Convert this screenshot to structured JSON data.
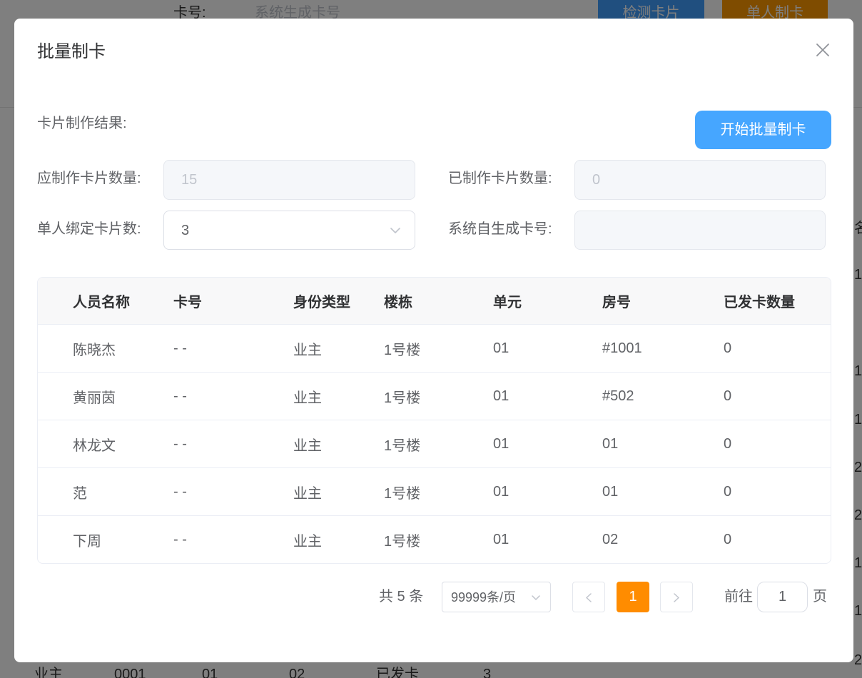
{
  "background": {
    "card_label": "卡号:",
    "card_placeholder": "系统生成卡号",
    "detect_button": "检测卡片",
    "single_button": "单人制卡",
    "bottom_row": [
      "业主",
      "0001",
      "01",
      "02",
      "已发卡",
      "3"
    ],
    "right_column": [
      "名",
      "1",
      "1",
      "1",
      "2",
      "2",
      "1",
      "1",
      "2"
    ]
  },
  "dialog": {
    "title": "批量制卡",
    "result_label": "卡片制作结果:",
    "start_button": "开始批量制卡",
    "fields": {
      "should_make_label": "应制作卡片数量:",
      "should_make_value": "15",
      "made_label": "已制作卡片数量:",
      "made_value": "0",
      "bind_count_label": "单人绑定卡片数:",
      "bind_count_value": "3",
      "system_card_label": "系统自生成卡号:"
    },
    "table": {
      "columns": [
        "人员名称",
        "卡号",
        "身份类型",
        "楼栋",
        "单元",
        "房号",
        "已发卡数量"
      ],
      "rows": [
        {
          "name": "陈晓杰",
          "card_no": "- -",
          "identity_type": "业主",
          "building": "1号楼",
          "unit": "01",
          "room": "#1001",
          "issued_count": "0"
        },
        {
          "name": "黄丽茵",
          "card_no": "- -",
          "identity_type": "业主",
          "building": "1号楼",
          "unit": "01",
          "room": "#502",
          "issued_count": "0"
        },
        {
          "name": "林龙文",
          "card_no": "- -",
          "identity_type": "业主",
          "building": "1号楼",
          "unit": "01",
          "room": "01",
          "issued_count": "0"
        },
        {
          "name": "范",
          "card_no": "- -",
          "identity_type": "业主",
          "building": "1号楼",
          "unit": "01",
          "room": "01",
          "issued_count": "0"
        },
        {
          "name": "下周",
          "card_no": "- -",
          "identity_type": "业主",
          "building": "1号楼",
          "unit": "01",
          "room": "02",
          "issued_count": "0"
        }
      ]
    },
    "pagination": {
      "total_text": "共 5 条",
      "page_size": "99999条/页",
      "current_page": "1",
      "goto_label": "前往",
      "goto_value": "1",
      "page_suffix": "页"
    }
  },
  "icons": {
    "close": "close-icon",
    "select_arrow": "chevron-down-icon",
    "prev": "chevron-left-icon",
    "next": "chevron-right-icon"
  },
  "colors": {
    "primary": "#409eff",
    "primary_light": "#46a6ff",
    "warning": "#ff9900",
    "pagination_active": "#ff8c00",
    "overlay": "rgba(0,0,0,0.5)"
  }
}
